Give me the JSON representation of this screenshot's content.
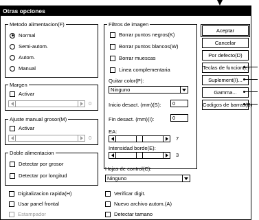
{
  "dialog": {
    "title": "Otras opciones"
  },
  "feed_method": {
    "legend": "Metodo alimentacion(F)",
    "options": [
      {
        "label": "Normal",
        "checked": true
      },
      {
        "label": "Semi-autom.",
        "checked": false
      },
      {
        "label": "Autom.",
        "checked": false
      },
      {
        "label": "Manual",
        "checked": false
      }
    ]
  },
  "margin": {
    "legend": "Margen",
    "activate_label": "Activar",
    "value_suffix": "0"
  },
  "thickness": {
    "legend": "Ajuste manual grosor(M)",
    "activate_label": "Activar",
    "value_suffix": "0"
  },
  "double_feed": {
    "legend": "Doble alimentacion",
    "by_thickness_label": "Detectar por grosor",
    "by_length_label": "Detectar por longitud"
  },
  "bottom_left": {
    "rapid_scan_label": "Digitalizacion rapida(H)",
    "front_panel_label": "Usar panel frontal",
    "stamper_label": "Estampador"
  },
  "image_filters": {
    "legend": "Filtros de imagen",
    "options": [
      {
        "label": "Borrar puntos negros(K)"
      },
      {
        "label": "Borrar puntos blancos(W)"
      },
      {
        "label": "Borrar muescas"
      },
      {
        "label": "Linea complementaria"
      }
    ],
    "drop_color_label": "Quitar color(P):",
    "drop_color_value": "Ninguno",
    "start_offset_label": "Inicio desact. (mm)(S):",
    "start_offset_value": "0",
    "end_offset_label": "Fin desact. (mm)(I):",
    "end_offset_value": "0",
    "ea_label": "EA:",
    "ea_value": "7",
    "ea_level": 0.5,
    "edge_intensity_label": "Intensidad borde(E):",
    "edge_intensity_value": "3",
    "edge_intensity_level": 0.5
  },
  "control_sheets": {
    "label": "Hojas de control(C):",
    "value": "Ninguno",
    "verify_digit_label": "Verificar digit.",
    "new_file_label": "Nuevo archivo autom.(A)",
    "detect_size_label": "Detectar tamano"
  },
  "buttons": {
    "accept": "Aceptar",
    "cancel": "Cancelar",
    "default": "Por defecto(D)",
    "function_keys": "Teclas de funcion(e)",
    "supplement": "Suplement(I)...",
    "gamma": "Gamma...",
    "barcodes": "Codigos de barras(B)"
  }
}
